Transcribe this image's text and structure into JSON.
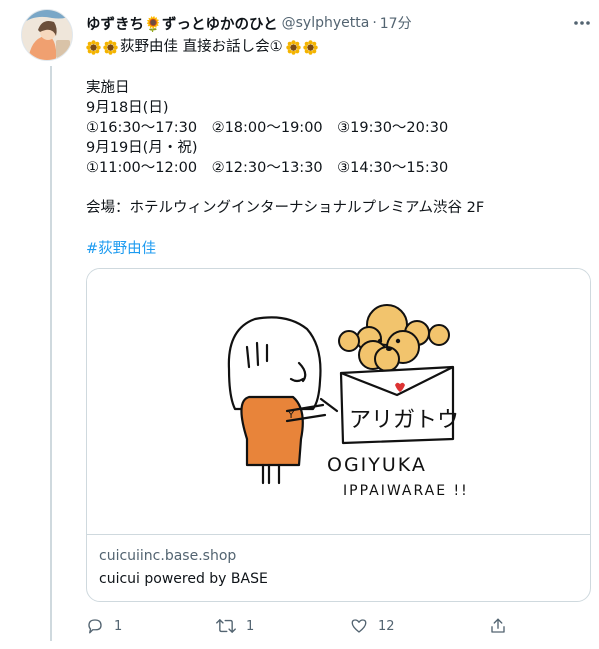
{
  "tweet": {
    "display_name": "ゆずきち🌻ずっとゆかのひと",
    "handle": "@sylphyetta",
    "separator": "·",
    "timestamp": "17分",
    "title": "荻野由佳 直接お話し会①",
    "lines": [
      "実施日",
      "9月18日(日)",
      "①16:30～17:30　②18:00～19:00　③19:30～20:30",
      "9月19日(月・祝)",
      "①11:00～12:00　②12:30～13:30　③14:30～15:30",
      "",
      "会場：ホテルウィングインターナショナルプレミアム渋谷 2F"
    ],
    "hashtag": "#荻野由佳"
  },
  "card": {
    "domain": "cuicuiinc.base.shop",
    "title": "cuicui powered by BASE",
    "illustration": {
      "envelope_text": "アリガトウ",
      "caption_line1": "OGIYUKA",
      "caption_line2": "IPPAIWARAE !!"
    }
  },
  "actions": {
    "reply_count": "1",
    "retweet_count": "1",
    "like_count": "12"
  },
  "colors": {
    "accent": "#1d9bf0",
    "secondary_text": "#536471",
    "border": "#cfd9de",
    "sunflower": "#f4b400"
  },
  "icons": [
    "more-icon",
    "sunflower-icon",
    "reply-icon",
    "retweet-icon",
    "like-icon",
    "share-icon"
  ]
}
